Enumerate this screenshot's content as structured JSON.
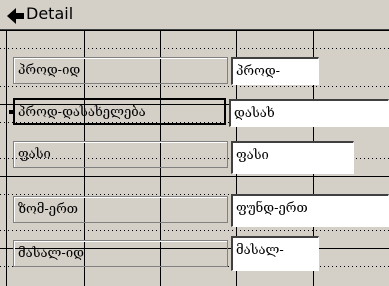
{
  "section": {
    "title": "Detail",
    "arrow_icon": "down-arrow-icon"
  },
  "fields": [
    {
      "label": "პროდ-იდ",
      "value": "პროდ-"
    },
    {
      "label": "პროდ-დასახელება",
      "value": "დასახ"
    },
    {
      "label": "ფასი",
      "value": "ფასი"
    },
    {
      "label": "ზომ-ერთ",
      "value": "ფუნდ-ერთ"
    },
    {
      "label": "მასალ-იდ",
      "value": "მასალ-"
    }
  ]
}
